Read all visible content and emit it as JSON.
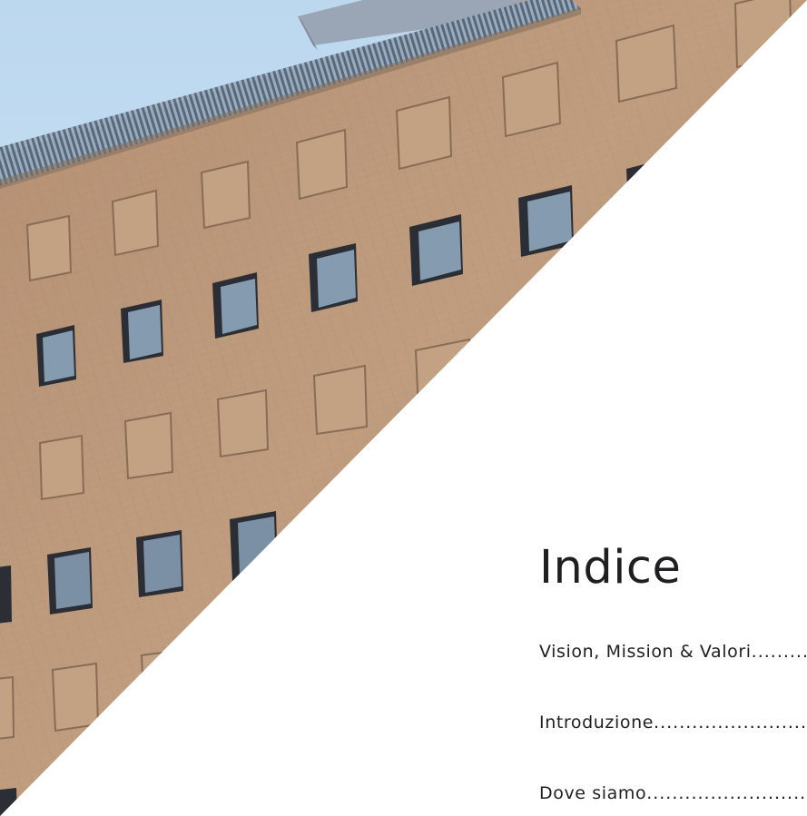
{
  "index": {
    "title": "Indice",
    "entries": [
      {
        "label": "Vision, Mission & Valori"
      },
      {
        "label": "Introduzione "
      },
      {
        "label": "Dove siamo"
      }
    ]
  },
  "cover_image": {
    "description_icon": "building-facade-photo"
  },
  "colors": {
    "text": "#1f1f22",
    "sky": "#c4ddf0",
    "brick": "#c39d7c",
    "background": "#ffffff"
  }
}
